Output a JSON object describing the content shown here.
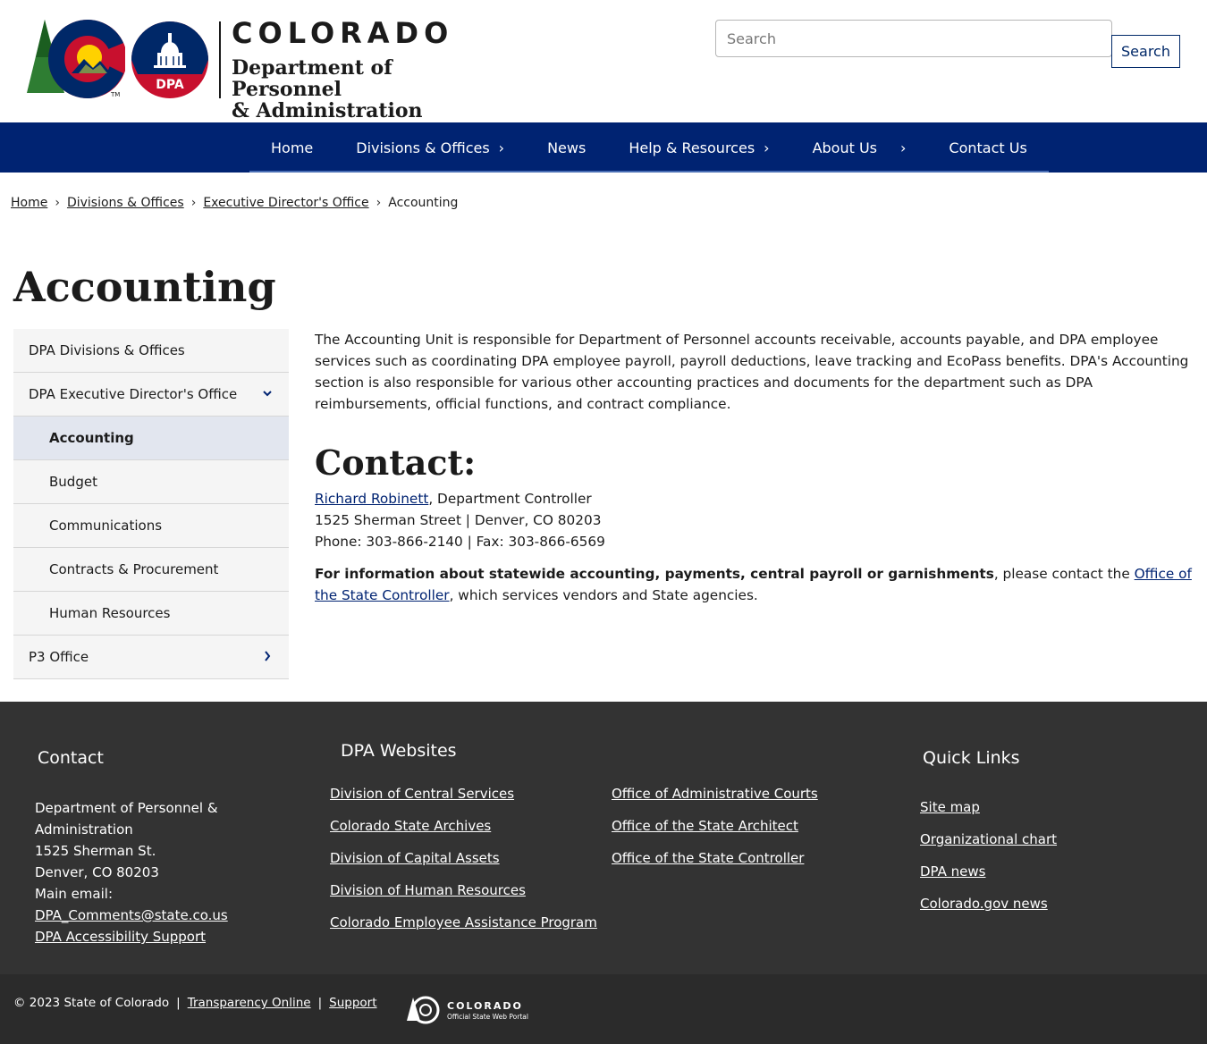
{
  "header": {
    "logo_state_text": "COLORADO",
    "logo_dept_line1": "Department of Personnel",
    "logo_dept_line2": "& Administration",
    "dpa_badge_text": "DPA",
    "search_placeholder": "Search",
    "search_button": "Search"
  },
  "nav": {
    "items": [
      {
        "label": "Home"
      },
      {
        "label": "Divisions & Offices"
      },
      {
        "label": "News"
      },
      {
        "label": "Help & Resources"
      },
      {
        "label": "About Us"
      },
      {
        "label": "Contact Us"
      }
    ]
  },
  "breadcrumb": {
    "items": [
      "Home",
      "Divisions & Offices",
      "Executive Director's Office",
      "Accounting"
    ],
    "separator": "›"
  },
  "page": {
    "title": "Accounting"
  },
  "sidenav": {
    "items": [
      {
        "label": "DPA Divisions & Offices"
      },
      {
        "label": "DPA Executive Director's Office"
      },
      {
        "label": "Accounting"
      },
      {
        "label": "Budget"
      },
      {
        "label": "Communications"
      },
      {
        "label": "Contracts & Procurement"
      },
      {
        "label": "Human Resources"
      },
      {
        "label": "P3 Office"
      }
    ]
  },
  "content": {
    "intro": "The Accounting Unit is responsible for Department of Personnel accounts receivable, accounts payable, and DPA employee services such as coordinating DPA employee payroll, payroll deductions, leave tracking and EcoPass benefits. DPA's Accounting section is also responsible for various other accounting practices and documents for the department such as DPA reimbursements, official functions, and contract compliance.",
    "contact_heading": "Contact:",
    "contact_name": "Richard Robinett",
    "contact_title": ", Department Controller",
    "contact_address": "1525 Sherman Street | Denver, CO 80203",
    "contact_phone": "Phone: 303-866-2140 | Fax: 303-866-6569",
    "info_bold": "For information about statewide accounting, payments, central payroll or garnishments",
    "info_mid": ", please contact the ",
    "info_link": "Office of the State Controller",
    "info_end": ", which services vendors and State agencies."
  },
  "footer": {
    "contact": {
      "heading": "Contact",
      "line1": "Department of Personnel &",
      "line2": "Administration",
      "line3": "1525 Sherman St.",
      "line4": "Denver, CO 80203",
      "line5": "Main email:",
      "email": "DPA_Comments@state.co.us",
      "accessibility": "DPA Accessibility Support"
    },
    "websites": {
      "heading": "DPA Websites",
      "col1": [
        "Division of Central Services",
        "Colorado State Archives",
        "Division of Capital Assets",
        "Division of Human Resources",
        "Colorado Employee Assistance Program"
      ],
      "col2": [
        "Office of Administrative Courts",
        "Office of the State Architect",
        "Office of the State Controller"
      ]
    },
    "quick": {
      "heading": "Quick Links",
      "links": [
        "Site map",
        "Organizational chart",
        "DPA news",
        "Colorado.gov news"
      ]
    }
  },
  "bottom": {
    "copyright": "© 2023 State of Colorado",
    "transparency": "Transparency Online",
    "support": "Support",
    "portal_line1": "COLORADO",
    "portal_line2": "Official State Web Portal"
  },
  "colors": {
    "nav_bg": "#002372",
    "footer_bg": "#333333",
    "bottom_bg": "#2b2b2b",
    "link": "#002372",
    "active_side": "#e2e6ef"
  }
}
